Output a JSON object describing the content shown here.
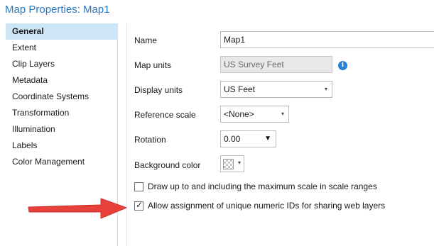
{
  "window": {
    "title": "Map Properties: Map1"
  },
  "sidebar": {
    "items": [
      {
        "label": "General",
        "active": true
      },
      {
        "label": "Extent"
      },
      {
        "label": "Clip Layers"
      },
      {
        "label": "Metadata"
      },
      {
        "label": "Coordinate Systems"
      },
      {
        "label": "Transformation"
      },
      {
        "label": "Illumination"
      },
      {
        "label": "Labels"
      },
      {
        "label": "Color Management"
      }
    ]
  },
  "general": {
    "name": {
      "label": "Name",
      "value": "Map1"
    },
    "map_units": {
      "label": "Map units",
      "value": "US Survey Feet",
      "info_glyph": "i"
    },
    "display_units": {
      "label": "Display units",
      "value": "US Feet"
    },
    "reference_scale": {
      "label": "Reference scale",
      "value": "<None>"
    },
    "rotation": {
      "label": "Rotation",
      "value": "0.00"
    },
    "background_color": {
      "label": "Background color"
    },
    "draw_max_scale": {
      "label": "Draw up to and including the maximum scale in scale ranges",
      "checked": false
    },
    "allow_unique_ids": {
      "label": "Allow assignment of unique numeric IDs for sharing web layers",
      "checked": true
    }
  },
  "annotation": {
    "arrow_color": "#e8403b"
  },
  "colors": {
    "accent": "#2b78c2",
    "selected_bg": "#cde6f7",
    "info_icon": "#2b7fd0"
  }
}
